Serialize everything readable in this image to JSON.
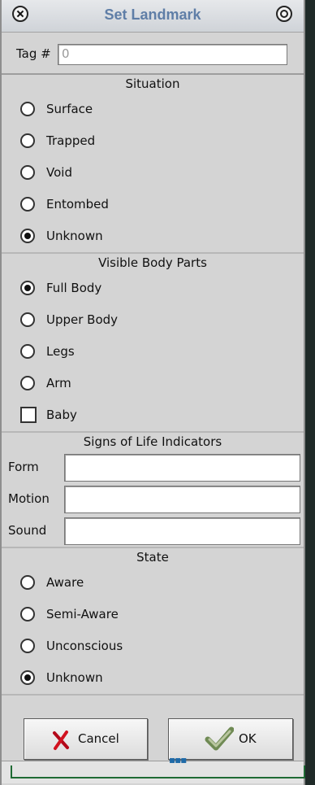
{
  "window": {
    "title": "Set Landmark"
  },
  "tag": {
    "label": "Tag #",
    "value": "0"
  },
  "sections": {
    "situation": {
      "title": "Situation",
      "options": [
        "Surface",
        "Trapped",
        "Void",
        "Entombed",
        "Unknown"
      ],
      "selected": "Unknown"
    },
    "visible_body_parts": {
      "title": "Visible Body Parts",
      "options": [
        "Full Body",
        "Upper Body",
        "Legs",
        "Arm"
      ],
      "selected": "Full Body",
      "checkbox_label": "Baby",
      "checkbox_checked": false
    },
    "signs_of_life": {
      "title": "Signs of Life Indicators",
      "fields": [
        {
          "label": "Form",
          "value": ""
        },
        {
          "label": "Motion",
          "value": ""
        },
        {
          "label": "Sound",
          "value": ""
        }
      ]
    },
    "state": {
      "title": "State",
      "options": [
        "Aware",
        "Semi-Aware",
        "Unconscious",
        "Unknown"
      ],
      "selected": "Unknown"
    }
  },
  "buttons": {
    "cancel": "Cancel",
    "ok": "OK"
  },
  "icons": {
    "close": "close-icon",
    "maximize": "maximize-icon",
    "cancel": "cancel-icon",
    "ok": "ok-icon"
  },
  "colors": {
    "title": "#5f7ea7",
    "dialog_bg": "#d4d4d4",
    "accent_green": "#1f6b34"
  }
}
